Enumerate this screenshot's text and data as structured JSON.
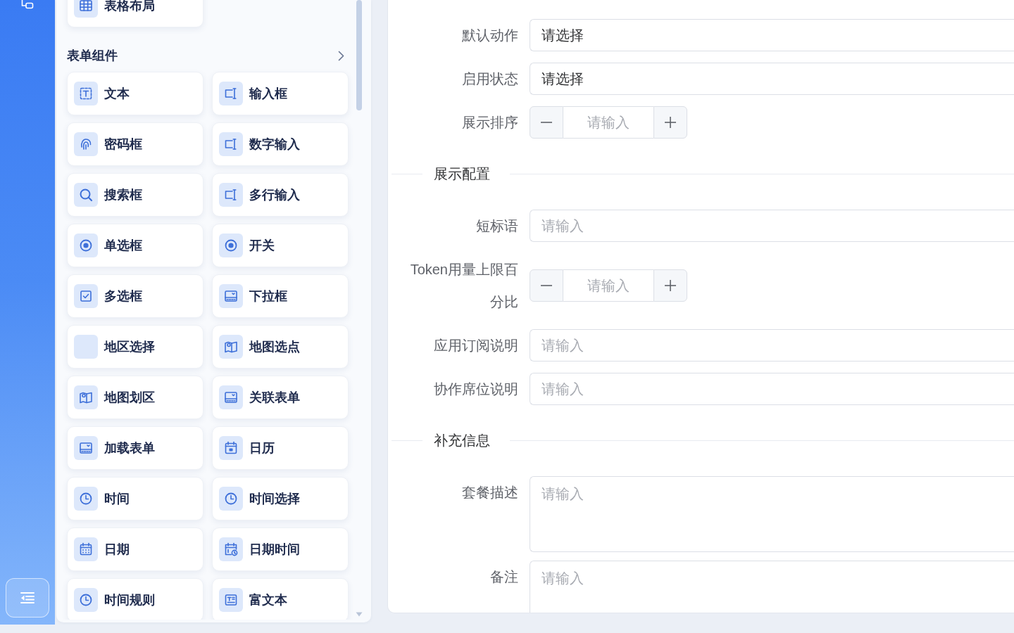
{
  "component_panel": {
    "top_items": [
      {
        "label": "表格布局"
      }
    ],
    "section": {
      "title": "表单组件",
      "items": [
        {
          "label": "文本"
        },
        {
          "label": "输入框"
        },
        {
          "label": "密码框"
        },
        {
          "label": "数字输入"
        },
        {
          "label": "搜索框"
        },
        {
          "label": "多行输入"
        },
        {
          "label": "单选框"
        },
        {
          "label": "开关"
        },
        {
          "label": "多选框"
        },
        {
          "label": "下拉框"
        },
        {
          "label": "地区选择"
        },
        {
          "label": "地图选点"
        },
        {
          "label": "地图划区"
        },
        {
          "label": "关联表单"
        },
        {
          "label": "加载表单"
        },
        {
          "label": "日历"
        },
        {
          "label": "时间"
        },
        {
          "label": "时间选择"
        },
        {
          "label": "日期"
        },
        {
          "label": "日期时间"
        },
        {
          "label": "时间规则"
        },
        {
          "label": "富文本"
        }
      ]
    }
  },
  "form": {
    "rows": [
      {
        "kind": "select",
        "label": "默认动作",
        "value": "请选择"
      },
      {
        "kind": "select",
        "label": "启用状态",
        "value": "请选择"
      },
      {
        "kind": "number",
        "label": "展示排序",
        "placeholder": "请输入"
      },
      {
        "kind": "divider",
        "title": "展示配置"
      },
      {
        "kind": "input",
        "label": "短标语",
        "placeholder": "请输入"
      },
      {
        "kind": "number",
        "label": "Token用量上限百分比",
        "placeholder": "请输入"
      },
      {
        "kind": "input",
        "label": "应用订阅说明",
        "placeholder": "请输入"
      },
      {
        "kind": "input",
        "label": "协作席位说明",
        "placeholder": "请输入"
      },
      {
        "kind": "divider",
        "title": "补充信息"
      },
      {
        "kind": "textarea",
        "label": "套餐描述",
        "placeholder": "请输入"
      },
      {
        "kind": "textarea",
        "label": "备注",
        "placeholder": "请输入"
      }
    ]
  }
}
